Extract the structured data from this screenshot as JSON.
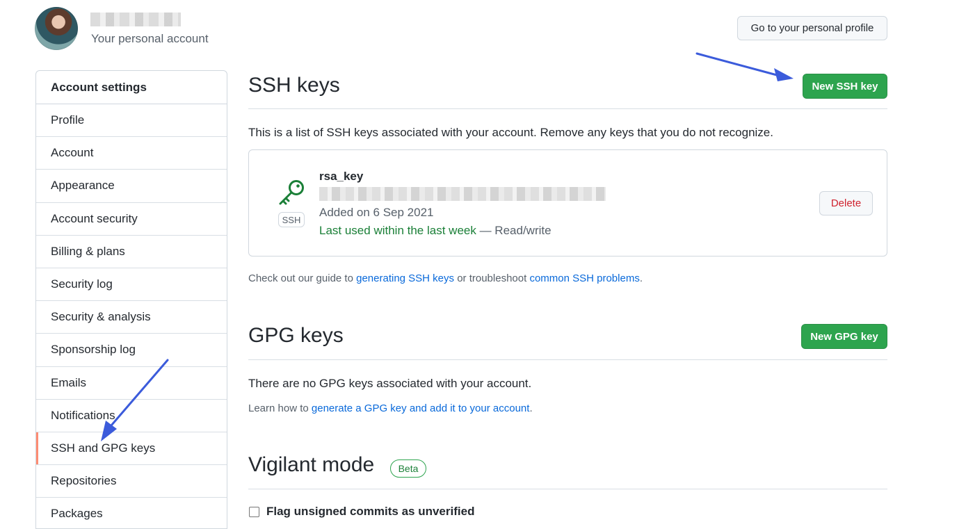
{
  "header": {
    "subtitle": "Your personal account",
    "profile_button": "Go to your personal profile"
  },
  "sidebar": {
    "header": "Account settings",
    "items": [
      {
        "label": "Profile"
      },
      {
        "label": "Account"
      },
      {
        "label": "Appearance"
      },
      {
        "label": "Account security"
      },
      {
        "label": "Billing & plans"
      },
      {
        "label": "Security log"
      },
      {
        "label": "Security & analysis"
      },
      {
        "label": "Sponsorship log"
      },
      {
        "label": "Emails"
      },
      {
        "label": "Notifications"
      },
      {
        "label": "SSH and GPG keys",
        "selected": true
      },
      {
        "label": "Repositories"
      },
      {
        "label": "Packages"
      }
    ]
  },
  "ssh": {
    "title": "SSH keys",
    "new_button": "New SSH key",
    "description": "This is a list of SSH keys associated with your account. Remove any keys that you do not recognize.",
    "key": {
      "name": "rsa_key",
      "type_label": "SSH",
      "added": "Added on 6 Sep 2021",
      "last_used": "Last used within the last week",
      "access": " — Read/write",
      "delete_button": "Delete"
    },
    "guide": {
      "prefix": "Check out our guide to ",
      "link1": "generating SSH keys",
      "middle": " or troubleshoot ",
      "link2": "common SSH problems",
      "suffix": "."
    }
  },
  "gpg": {
    "title": "GPG keys",
    "new_button": "New GPG key",
    "empty_text": "There are no GPG keys associated with your account.",
    "learn": {
      "prefix": "Learn how to ",
      "link": "generate a GPG key and add it to your account",
      "suffix": "."
    }
  },
  "vigilant": {
    "title": "Vigilant mode",
    "badge": "Beta",
    "checkbox_label": "Flag unsigned commits as unverified"
  },
  "colors": {
    "primary_green": "#2da44e",
    "link_blue": "#0969da",
    "danger_red": "#cf222e",
    "selected_marker": "#fd8c73",
    "annotation_arrow": "#3b5bdb"
  },
  "icons": {
    "key": "key-icon",
    "avatar": "user-avatar"
  }
}
